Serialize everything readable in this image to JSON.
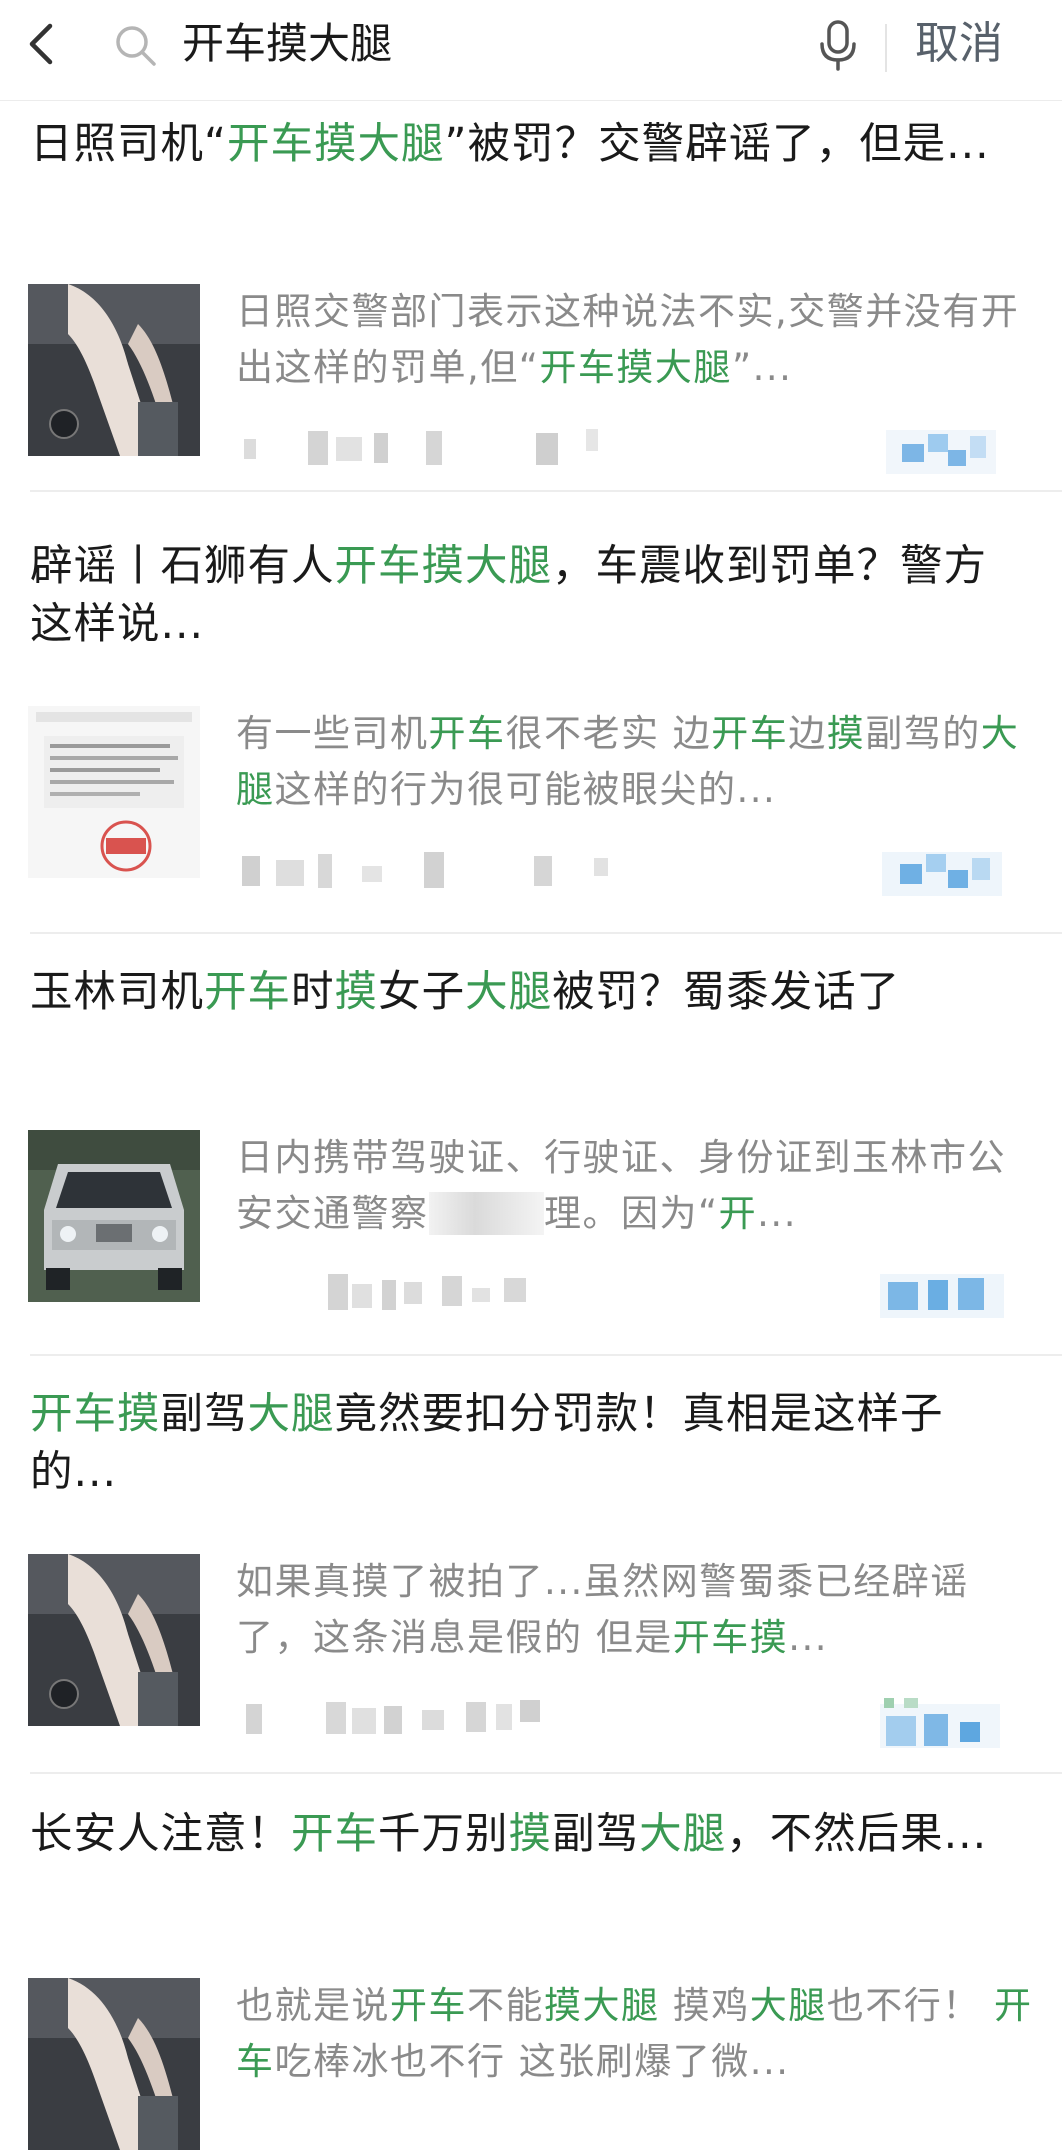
{
  "topbar": {
    "query": "开车摸大腿",
    "cancel": "取消"
  },
  "results": [
    {
      "title": [
        {
          "t": "日照司机“"
        },
        {
          "t": "开车摸大腿",
          "hl": true
        },
        {
          "t": "”被罚？交警辟谣了，但是..."
        }
      ],
      "snippet": [
        {
          "t": "日照交警部门表示这种说法不实,交警并没有开出这样的罚单,但“"
        },
        {
          "t": "开车摸大腿",
          "hl": true
        },
        {
          "t": "”..."
        }
      ]
    },
    {
      "title": [
        {
          "t": "辟谣丨石狮有人"
        },
        {
          "t": "开车摸大腿",
          "hl": true
        },
        {
          "t": "，车震收到罚单？警方这样说..."
        }
      ],
      "snippet": [
        {
          "t": "有一些司机"
        },
        {
          "t": "开车",
          "hl": true
        },
        {
          "t": "很不老实 边"
        },
        {
          "t": "开车",
          "hl": true
        },
        {
          "t": "边"
        },
        {
          "t": "摸",
          "hl": true
        },
        {
          "t": "副驾的"
        },
        {
          "t": "大腿",
          "hl": true
        },
        {
          "t": "这样的行为很可能被眼尖的..."
        }
      ]
    },
    {
      "title": [
        {
          "t": "玉林司机"
        },
        {
          "t": "开车",
          "hl": true
        },
        {
          "t": "时"
        },
        {
          "t": "摸",
          "hl": true
        },
        {
          "t": "女子"
        },
        {
          "t": "大腿",
          "hl": true
        },
        {
          "t": "被罚？蜀黍发话了"
        }
      ],
      "snippet": [
        {
          "t": "日内携带驾驶证、行驶证、身份证到玉林市公安交通警察"
        },
        {
          "t": "　　　",
          "blur": true
        },
        {
          "t": "理。因为“"
        },
        {
          "t": "开",
          "hl": true
        },
        {
          "t": "..."
        }
      ]
    },
    {
      "title": [
        {
          "t": "开车摸",
          "hl": true
        },
        {
          "t": "副驾"
        },
        {
          "t": "大腿",
          "hl": true
        },
        {
          "t": "竟然要扣分罚款！真相是这样子的..."
        }
      ],
      "snippet": [
        {
          "t": "如果真摸了被拍了...虽然网警蜀黍已经辟谣了，这条消息是假的 但是"
        },
        {
          "t": "开车摸",
          "hl": true
        },
        {
          "t": "..."
        }
      ]
    },
    {
      "title": [
        {
          "t": "长安人注意！"
        },
        {
          "t": "开车",
          "hl": true
        },
        {
          "t": "千万别"
        },
        {
          "t": "摸",
          "hl": true
        },
        {
          "t": "副驾"
        },
        {
          "t": "大腿",
          "hl": true
        },
        {
          "t": "，不然后果..."
        }
      ],
      "snippet": [
        {
          "t": "也就是说"
        },
        {
          "t": "开车",
          "hl": true
        },
        {
          "t": "不能"
        },
        {
          "t": "摸大腿",
          "hl": true
        },
        {
          "t": " 摸鸡"
        },
        {
          "t": "大腿",
          "hl": true
        },
        {
          "t": "也不行！ "
        },
        {
          "t": "开车",
          "hl": true
        },
        {
          "t": "吃棒冰也不行 这张刷爆了微..."
        }
      ]
    }
  ],
  "colors": {
    "highlight": "#3a9a53",
    "title": "#1a1a1a",
    "snippet": "#8a8a8a",
    "cancel": "#58616b"
  },
  "icons": [
    "back-chevron-icon",
    "search-icon",
    "microphone-icon"
  ]
}
